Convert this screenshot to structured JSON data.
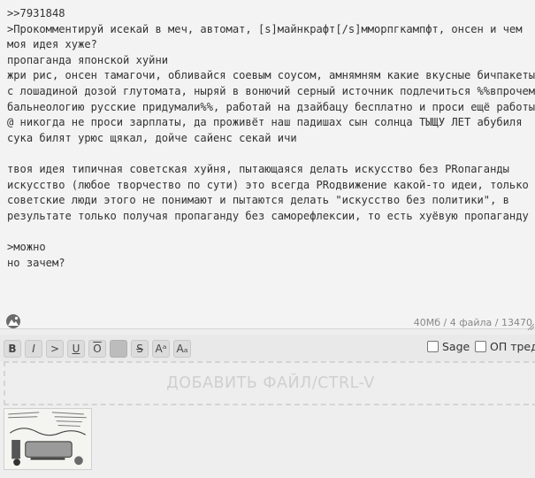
{
  "post": {
    "text": ">>7931848\n>Прокомментируй исекай в меч, автомат, [s]майнкрафт[/s]ммopпгкампфт, онсен и чем моя идея хуже?\nпропаганда японской хуйни\nжри рис, онсен тамагочи, обливайся соевым соусом, амнямням какие вкусные бичпакеты с лошадиной дозой глутомата, ныряй в вонючий серный источник подлечиться %%впрочем бальнеологию русские придумали%%, работай на дзайбацу бесплатно и проси ещё работы @ никогда не проси зарплаты, да проживёт наш падишах сын солнца ТЫЩУ ЛЕТ абубиля сука билят урюс щякал, дойче сайенс секай ичи\n\nтвоя идея типичная советская хуйня, пытающаяся делать искусство без PRопаганды искусство (любое творчество по сути) это всегда PRодвижение какой-то идеи, только советские люди этого не понимают и пытаются делать \"искусство без политики\", в результате только получая пропаганду без саморефлексии, то есть хуёвую пропаганду\n\n>можно\nно зачем?"
  },
  "counters": "40Мб / 4 файла / 13470",
  "toolbar": {
    "bold": "B",
    "italic": "I",
    "quote": ">",
    "underline": "U",
    "overline": "O",
    "spoiler": "",
    "strike": "S",
    "sup": "Aᵃ",
    "sub": "Aₐ"
  },
  "options": {
    "sage": "Sage",
    "op": "ОП треда"
  },
  "dropzone": "ДОБАВИТЬ ФАЙЛ/CTRL-V",
  "icons": {
    "avatar": "avatar-icon",
    "resize": "resize-handle-icon"
  },
  "attachment": {
    "description": "attached-image-thumbnail"
  }
}
